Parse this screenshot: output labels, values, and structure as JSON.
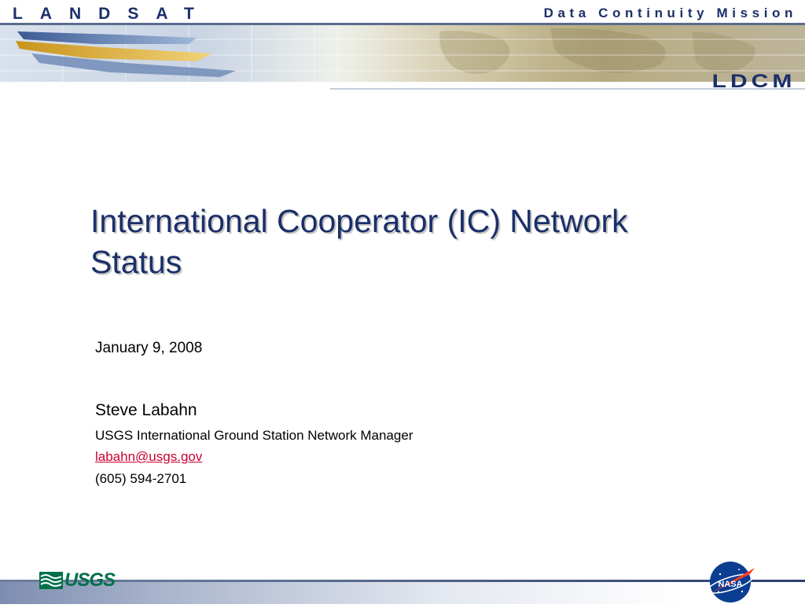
{
  "header": {
    "brand_left": "LANDSAT",
    "brand_right": "Data Continuity Mission",
    "logo_text": "LDCM"
  },
  "slide": {
    "title": "International Cooperator (IC) Network Status",
    "date": "January 9, 2008",
    "author": "Steve Labahn",
    "role": "USGS International Ground Station Network Manager",
    "email": "labahn@usgs.gov",
    "phone": "(605) 594-2701"
  },
  "footer": {
    "usgs_logo_text": "USGS",
    "nasa_logo_text": "NASA"
  },
  "colors": {
    "brand_navy": "#1b2f69",
    "link_red": "#cc0033",
    "usgs_green": "#00704a",
    "nasa_blue": "#0b3d91"
  }
}
